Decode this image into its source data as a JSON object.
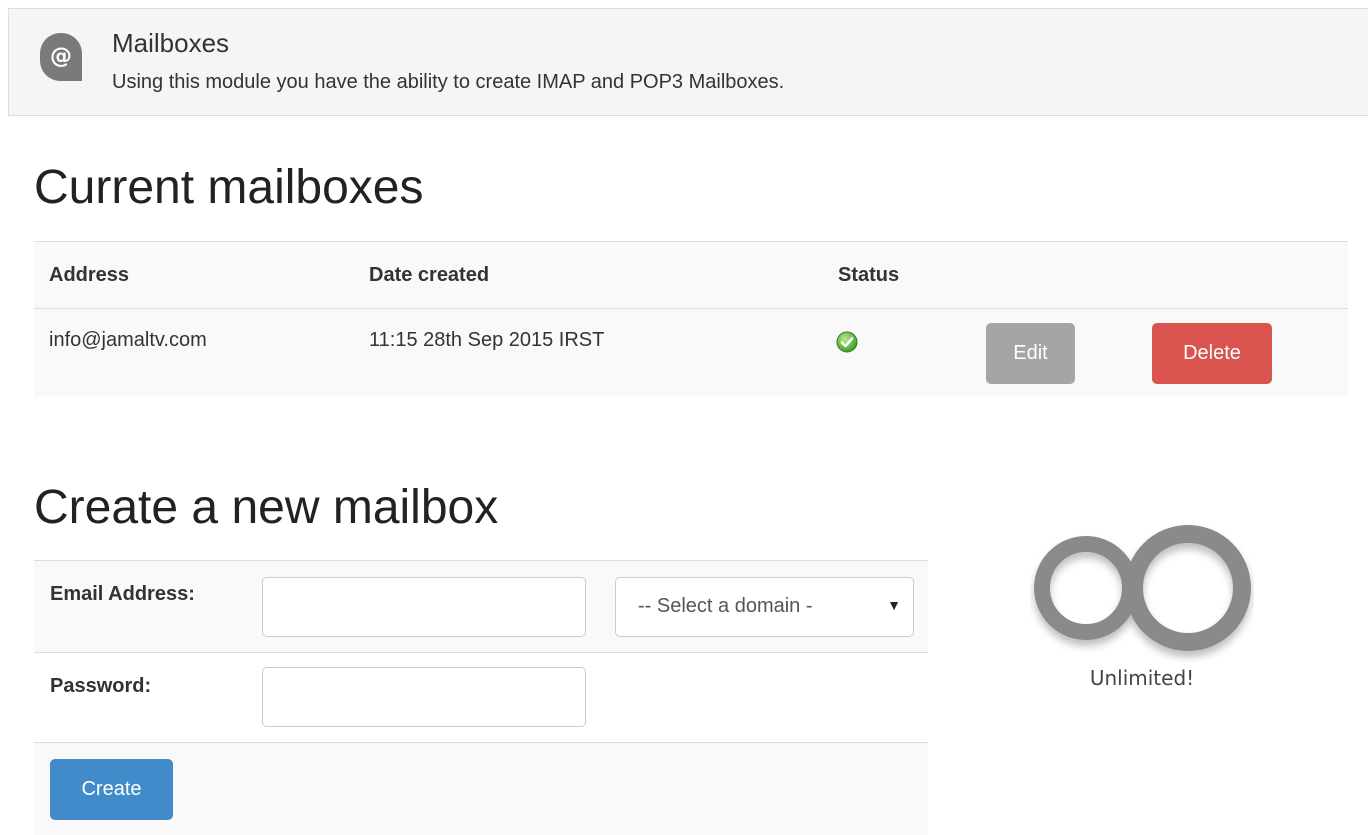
{
  "module": {
    "icon": "at-sign-icon",
    "title": "Mailboxes",
    "description": "Using this module you have the ability to create IMAP and POP3 Mailboxes."
  },
  "current": {
    "heading": "Current mailboxes",
    "columns": [
      "Address",
      "Date created",
      "Status"
    ],
    "rows": [
      {
        "address": "info@jamaltv.com",
        "date_created": "11:15 28th Sep 2015 IRST",
        "status_icon": "check-circle-icon",
        "edit_label": "Edit",
        "delete_label": "Delete"
      }
    ]
  },
  "create": {
    "heading": "Create a new mailbox",
    "email_label": "Email Address:",
    "email_value": "",
    "domain_select": {
      "selected": "-- Select a domain -",
      "caret_icon": "caret-down-icon"
    },
    "password_label": "Password:",
    "password_value": "",
    "create_label": "Create"
  },
  "unlimited": {
    "icon": "infinity-icon",
    "label": "Unlimited!"
  },
  "colors": {
    "edit_button": "#a5a5a5",
    "delete_button": "#d9534f",
    "create_button": "#428bca",
    "status_ok": "#5cb85c",
    "infinity": "#8a8a8a"
  }
}
